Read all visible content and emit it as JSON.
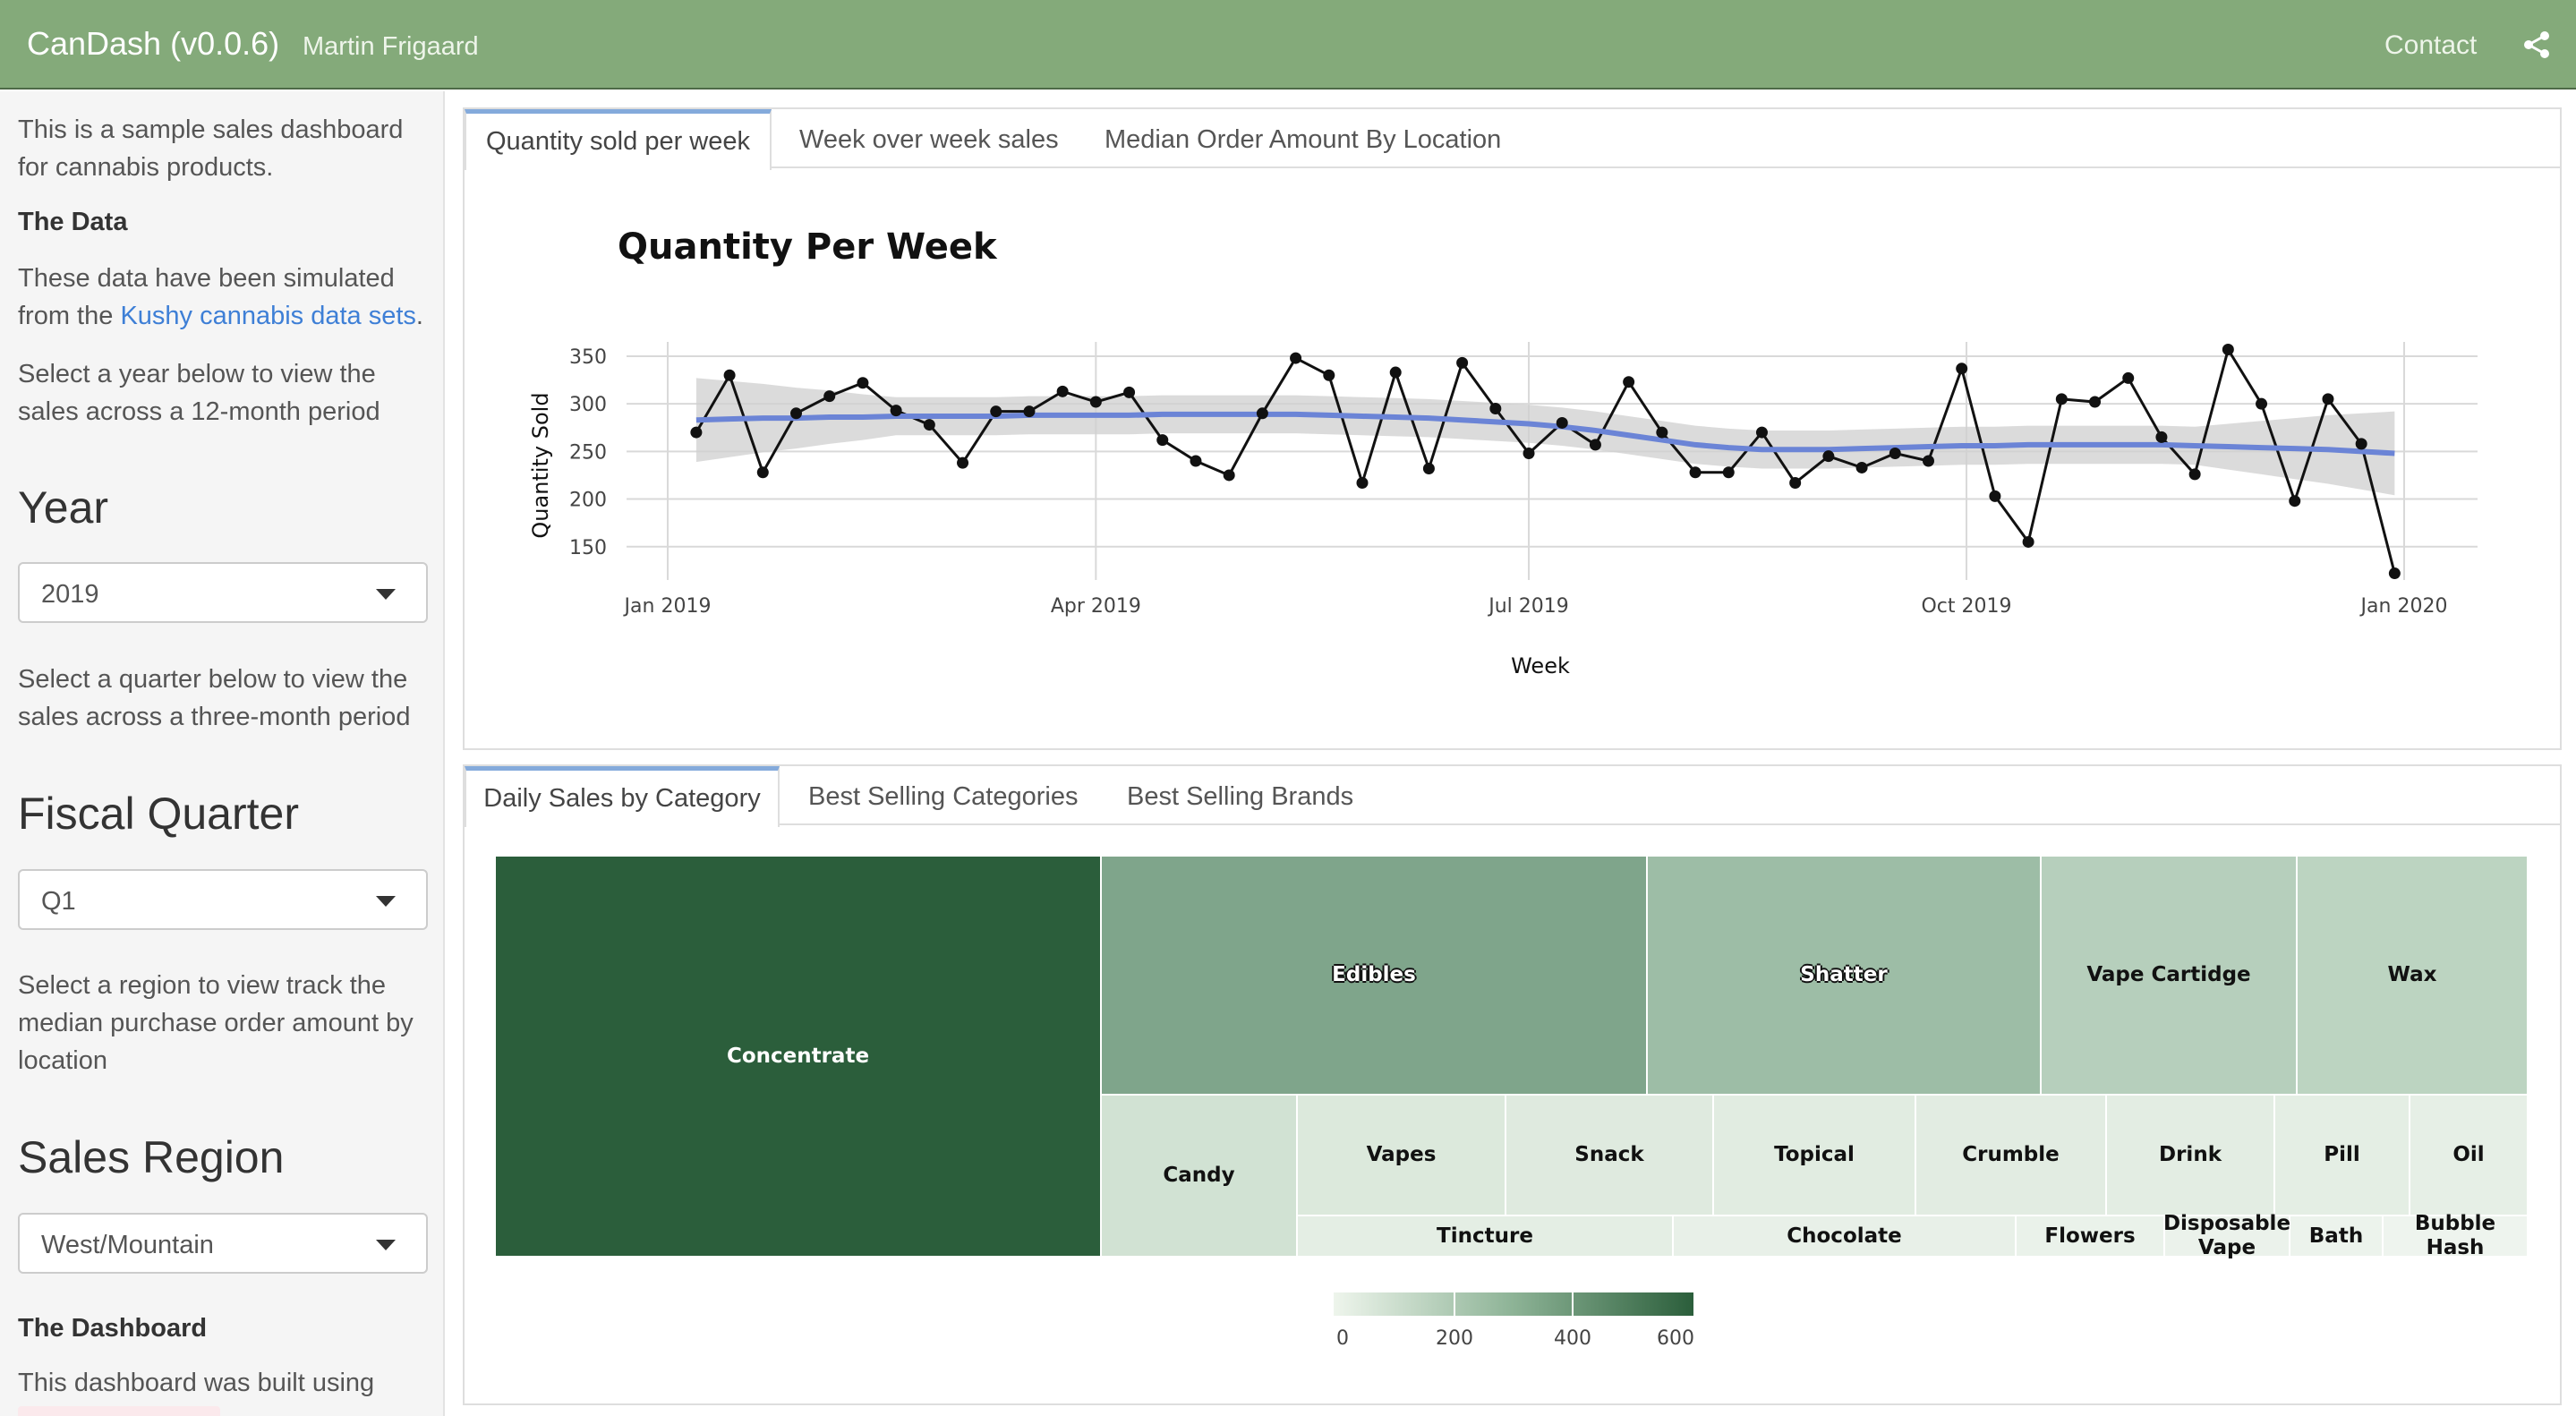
{
  "navbar": {
    "title": "CanDash (v0.0.6)",
    "author": "Martin Frigaard",
    "contact_label": "Contact",
    "share_icon": "share-icon"
  },
  "sidebar": {
    "intro": "This is a sample sales dashboard for cannabis products.",
    "data_heading": "The Data",
    "data_text_pre": "These data have been simulated from the ",
    "data_link": "Kushy cannabis data sets",
    "data_text_post": ".",
    "year_help": "Select a year below to view the sales across a 12-month period",
    "year_heading": "Year",
    "year_value": "2019",
    "quarter_help": "Select a quarter below to view the sales across a three-month period",
    "quarter_heading": "Fiscal Quarter",
    "quarter_value": "Q1",
    "region_help": "Select a region to view track the median purchase order amount by location",
    "region_heading": "Sales Region",
    "region_value": "West/Mountain",
    "dashboard_heading": "The Dashboard",
    "dashboard_text": "This dashboard was built using"
  },
  "top_panel": {
    "tabs": [
      {
        "label": "Quantity sold per week",
        "active": true
      },
      {
        "label": "Week over week sales",
        "active": false
      },
      {
        "label": "Median Order Amount By Location",
        "active": false
      }
    ]
  },
  "bottom_panel": {
    "tabs": [
      {
        "label": "Daily Sales by Category",
        "active": true
      },
      {
        "label": "Best Selling Categories",
        "active": false
      },
      {
        "label": "Best Selling Brands",
        "active": false
      }
    ]
  },
  "chart_data": [
    {
      "type": "line",
      "title": "Quantity Per Week",
      "xlabel": "Week",
      "ylabel": "Quantity Sold",
      "x_ticks": [
        "Jan 2019",
        "Apr 2019",
        "Jul 2019",
        "Oct 2019",
        "Jan 2020"
      ],
      "y_ticks": [
        150,
        200,
        250,
        300,
        350
      ],
      "ylim": [
        115,
        365
      ],
      "grid": true,
      "x_start": "2019-01-07",
      "x_step_days": 7,
      "series": [
        {
          "values": [
            270,
            330,
            228,
            290,
            308,
            322,
            293,
            278,
            238,
            292,
            292,
            313,
            302,
            312,
            262,
            240,
            225,
            290,
            348,
            330,
            217,
            333,
            232,
            343,
            295,
            248,
            280,
            257,
            323,
            270,
            228,
            228,
            270,
            217,
            245,
            233,
            248,
            240,
            337,
            203,
            155,
            305,
            302,
            327,
            265,
            226,
            357,
            300,
            198,
            305,
            258,
            122
          ],
          "color": "#111111"
        },
        {
          "values": [
            283,
            284,
            285,
            285,
            286,
            286,
            287,
            287,
            287,
            287,
            288,
            288,
            288,
            288,
            289,
            289,
            289,
            289,
            289,
            288,
            287,
            286,
            285,
            283,
            281,
            279,
            276,
            272,
            267,
            262,
            257,
            254,
            252,
            252,
            252,
            253,
            254,
            255,
            256,
            256,
            257,
            257,
            257,
            257,
            257,
            256,
            255,
            254,
            253,
            252,
            250,
            248
          ],
          "color": "#6b84d6",
          "style": "smooth"
        }
      ]
    },
    {
      "type": "heatmap",
      "subtype": "treemap",
      "legend_ticks": [
        0,
        200,
        400,
        600
      ],
      "cells": [
        {
          "label": "Concentrate",
          "color": "#2b5e3b",
          "text": "light"
        },
        {
          "label": "Edibles",
          "color": "#7fa58b",
          "text": "outline"
        },
        {
          "label": "Shatter",
          "color": "#9dbda6",
          "text": "outline"
        },
        {
          "label": "Vape Cartidge",
          "color": "#b6cfbc",
          "text": "dark"
        },
        {
          "label": "Wax",
          "color": "#bcd4c1",
          "text": "dark"
        },
        {
          "label": "Candy",
          "color": "#d1e2d3",
          "text": "dark"
        },
        {
          "label": "Vapes",
          "color": "#dce9dc",
          "text": "dark"
        },
        {
          "label": "Snack",
          "color": "#dfeadf",
          "text": "dark"
        },
        {
          "label": "Topical",
          "color": "#e1ece1",
          "text": "dark"
        },
        {
          "label": "Crumble",
          "color": "#e2ece2",
          "text": "dark"
        },
        {
          "label": "Drink",
          "color": "#e3ede3",
          "text": "dark"
        },
        {
          "label": "Pill",
          "color": "#e4eee4",
          "text": "dark"
        },
        {
          "label": "Oil",
          "color": "#e6efe6",
          "text": "dark"
        },
        {
          "label": "Tincture",
          "color": "#e4eee4",
          "text": "dark"
        },
        {
          "label": "Chocolate",
          "color": "#e8f0e8",
          "text": "dark"
        },
        {
          "label": "Flowers",
          "color": "#eaf2ea",
          "text": "dark"
        },
        {
          "label": "Disposable Vape",
          "color": "#ebf2eb",
          "text": "dark"
        },
        {
          "label": "Bath",
          "color": "#ecf3ec",
          "text": "dark"
        },
        {
          "label": "Bubble Hash",
          "color": "#eef4ee",
          "text": "dark"
        }
      ]
    }
  ]
}
